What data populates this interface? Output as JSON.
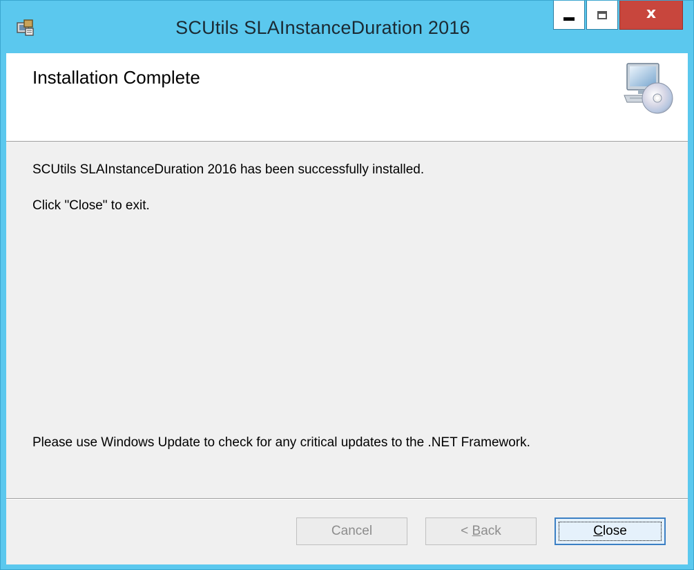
{
  "window": {
    "title": "SCUtils SLAInstanceDuration 2016",
    "controls": {
      "minimize_icon": "minimize-icon",
      "maximize_icon": "maximize-icon",
      "close_glyph": "x"
    }
  },
  "banner": {
    "title": "Installation Complete",
    "graphic": "computer-cd-icon"
  },
  "messages": {
    "success": "SCUtils SLAInstanceDuration 2016 has been successfully installed.",
    "exit_hint": "Click \"Close\" to exit.",
    "update_note": "Please use Windows Update to check for any critical updates to the .NET Framework."
  },
  "buttons": {
    "cancel": "Cancel",
    "back_prefix": "< ",
    "back_accel": "B",
    "back_rest": "ack",
    "close_accel": "C",
    "close_rest": "lose"
  },
  "colors": {
    "title_bar": "#5bc8ee",
    "close_button": "#c8463d",
    "dialog_body": "#f0f0f0"
  }
}
